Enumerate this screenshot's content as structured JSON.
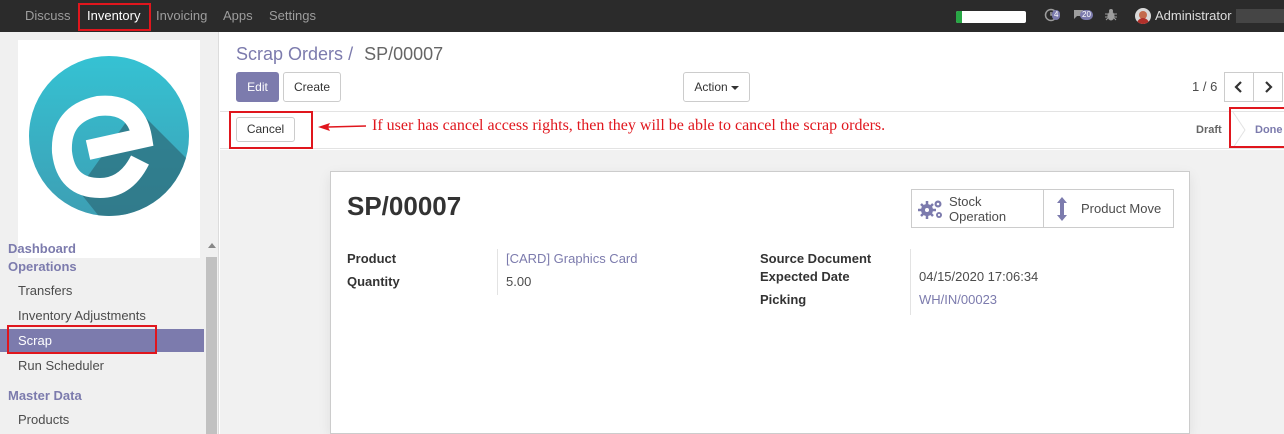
{
  "navbar": {
    "menus": [
      "Discuss",
      "Inventory",
      "Invoicing",
      "Apps",
      "Settings"
    ],
    "active_menu": "Inventory",
    "progress_fraction": 0.08,
    "activity_count": "4",
    "messages_count": "20",
    "user_name": "Administrator",
    "icons": [
      "activity-clock-icon",
      "chat-bubbles-icon",
      "bug-icon"
    ]
  },
  "sidebar": {
    "logo_letter": "e",
    "groups": [
      {
        "title": "Dashboard",
        "items": []
      },
      {
        "title": "Operations",
        "items": [
          "Transfers",
          "Inventory Adjustments",
          "Scrap",
          "Run Scheduler"
        ]
      },
      {
        "title": "Master Data",
        "items": [
          "Products"
        ]
      }
    ],
    "active_item": "Scrap"
  },
  "control_panel": {
    "breadcrumb_parent": "Scrap Orders",
    "breadcrumb_separator": "/",
    "breadcrumb_current": "SP/00007",
    "edit_label": "Edit",
    "create_label": "Create",
    "action_label": "Action",
    "pager_value": "1 / 6"
  },
  "statusbar": {
    "cancel_label": "Cancel",
    "states": [
      "Draft",
      "Done"
    ],
    "current_state": "Done"
  },
  "annotation": {
    "text": "If user has cancel access rights, then they will be able to cancel the scrap orders."
  },
  "form": {
    "name": "SP/00007",
    "smart_buttons": [
      {
        "line1": "Stock",
        "line2": "Operation",
        "icon": "gears-icon"
      },
      {
        "label": "Product Move",
        "icon": "vertical-arrows-icon"
      }
    ],
    "product_label": "Product",
    "product_value": "[CARD] Graphics Card",
    "quantity_label": "Quantity",
    "quantity_value": "5.00",
    "source_document_label": "Source Document",
    "source_document_value": "",
    "expected_date_label": "Expected Date",
    "expected_date_value": "04/15/2020 17:06:34",
    "picking_label": "Picking",
    "picking_value": "WH/IN/00023"
  },
  "colors": {
    "navbar_bg": "#2b2b2b",
    "brand": "#7c7bad",
    "annotation_red": "#e0161d",
    "logo_teal": "#3fb7c8"
  }
}
